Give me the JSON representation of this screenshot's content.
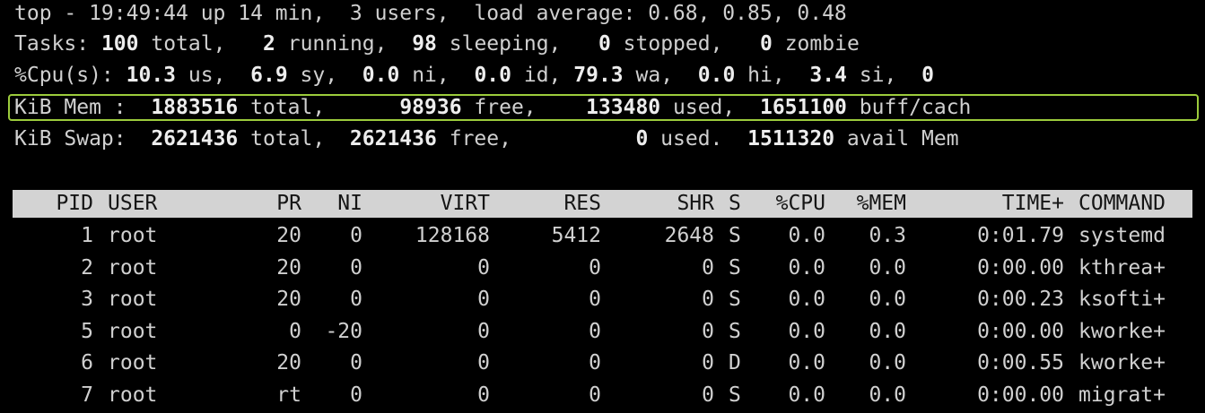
{
  "summary": {
    "top_line": "top - 19:49:44 up 14 min,  3 users,  load average: 0.68, 0.85, 0.48",
    "tasks": {
      "label": "Tasks:",
      "total": "100",
      "total_label": "total,",
      "running": "2",
      "running_label": "running,",
      "sleeping": "98",
      "sleeping_label": "sleeping,",
      "stopped": "0",
      "stopped_label": "stopped,",
      "zombie": "0",
      "zombie_label": "zombie"
    },
    "cpu": {
      "label": "%Cpu(s):",
      "us": "10.3",
      "us_label": "us,",
      "sy": "6.9",
      "sy_label": "sy,",
      "ni": "0.0",
      "ni_label": "ni,",
      "id": "0.0",
      "id_label": "id,",
      "wa": "79.3",
      "wa_label": "wa,",
      "hi": "0.0",
      "hi_label": "hi,",
      "si": "3.4",
      "si_label": "si,",
      "st": "0"
    },
    "mem": {
      "label": "KiB Mem :",
      "total": "1883516",
      "total_label": "total,",
      "free": "98936",
      "free_label": "free,",
      "used": "133480",
      "used_label": "used,",
      "buff": "1651100",
      "buff_label": "buff/cach"
    },
    "swap": {
      "label": "KiB Swap:",
      "total": "2621436",
      "total_label": "total,",
      "free": "2621436",
      "free_label": "free,",
      "used": "0",
      "used_label": "used.",
      "avail": "1511320",
      "avail_label": "avail Mem"
    }
  },
  "table": {
    "columns": {
      "pid": "PID",
      "user": "USER",
      "pr": "PR",
      "ni": "NI",
      "virt": "VIRT",
      "res": "RES",
      "shr": "SHR",
      "s": "S",
      "cpu": "%CPU",
      "mem": "%MEM",
      "time": "TIME+",
      "command": "COMMAND"
    },
    "rows": [
      {
        "pid": "1",
        "user": "root",
        "pr": "20",
        "ni": "0",
        "virt": "128168",
        "res": "5412",
        "shr": "2648",
        "s": "S",
        "cpu": "0.0",
        "mem": "0.3",
        "time": "0:01.79",
        "command": "systemd"
      },
      {
        "pid": "2",
        "user": "root",
        "pr": "20",
        "ni": "0",
        "virt": "0",
        "res": "0",
        "shr": "0",
        "s": "S",
        "cpu": "0.0",
        "mem": "0.0",
        "time": "0:00.00",
        "command": "kthrea+"
      },
      {
        "pid": "3",
        "user": "root",
        "pr": "20",
        "ni": "0",
        "virt": "0",
        "res": "0",
        "shr": "0",
        "s": "S",
        "cpu": "0.0",
        "mem": "0.0",
        "time": "0:00.23",
        "command": "ksofti+"
      },
      {
        "pid": "5",
        "user": "root",
        "pr": "0",
        "ni": "-20",
        "virt": "0",
        "res": "0",
        "shr": "0",
        "s": "S",
        "cpu": "0.0",
        "mem": "0.0",
        "time": "0:00.00",
        "command": "kworke+"
      },
      {
        "pid": "6",
        "user": "root",
        "pr": "20",
        "ni": "0",
        "virt": "0",
        "res": "0",
        "shr": "0",
        "s": "D",
        "cpu": "0.0",
        "mem": "0.0",
        "time": "0:00.55",
        "command": "kworke+"
      },
      {
        "pid": "7",
        "user": "root",
        "pr": "rt",
        "ni": "0",
        "virt": "0",
        "res": "0",
        "shr": "0",
        "s": "S",
        "cpu": "0.0",
        "mem": "0.0",
        "time": "0:00.00",
        "command": "migrat+"
      }
    ]
  },
  "colors": {
    "background": "#000000",
    "text": "#d0d0d0",
    "header_bar": "#d3d3d3",
    "highlight_border": "#9ccc3c"
  }
}
